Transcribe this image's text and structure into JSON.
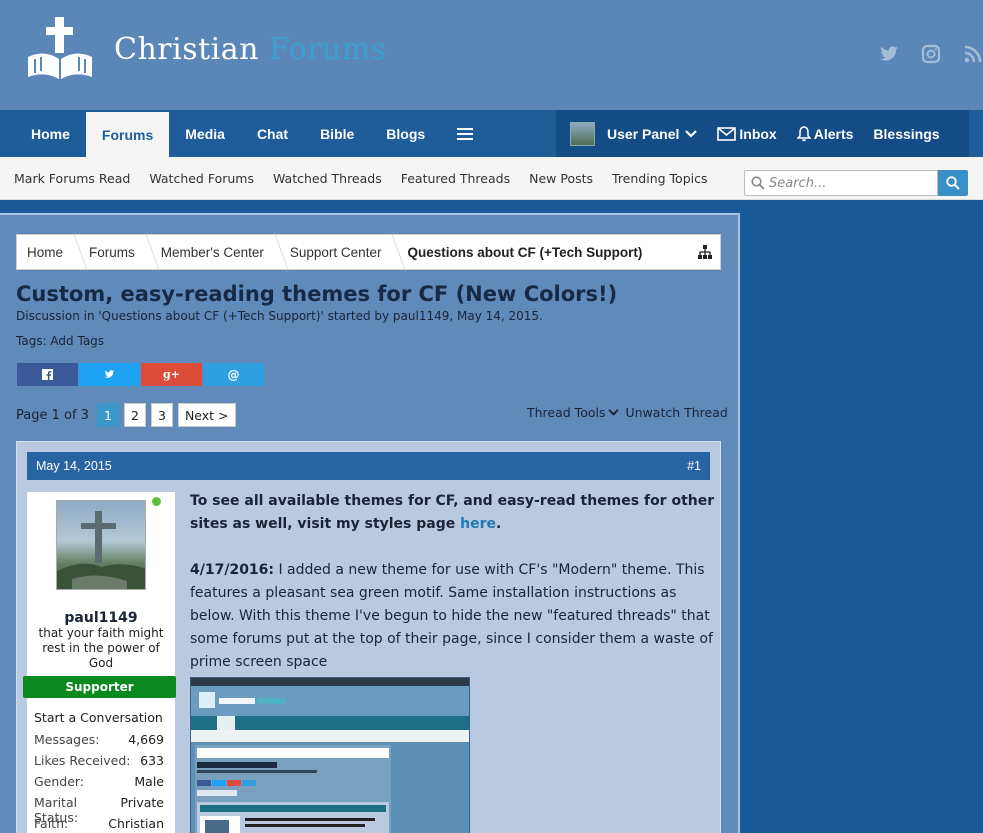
{
  "header": {
    "logo_word_1": "Christian",
    "logo_word_2": "Forums"
  },
  "nav": {
    "left_tabs": [
      "Home",
      "Forums",
      "Media",
      "Chat",
      "Bible",
      "Blogs"
    ],
    "active_tab": "Forums",
    "user_panel": "User Panel",
    "inbox": "Inbox",
    "alerts": "Alerts",
    "blessings": "Blessings"
  },
  "subnav": {
    "links": [
      "Mark Forums Read",
      "Watched Forums",
      "Watched Threads",
      "Featured Threads",
      "New Posts",
      "Trending Topics"
    ]
  },
  "search": {
    "placeholder": "Search..."
  },
  "breadcrumb": [
    "Home",
    "Forums",
    "Member's Center",
    "Support Center",
    "Questions about CF (+Tech Support)"
  ],
  "thread": {
    "title": "Custom, easy-reading themes for CF (New Colors!)",
    "meta": "Discussion in 'Questions about CF (+Tech Support)' started by paul1149, May 14, 2015.",
    "tags": "Tags: Add Tags"
  },
  "pagination": {
    "label": "Page 1 of 3",
    "pages": [
      "1",
      "2",
      "3"
    ],
    "current": "1",
    "next": "Next >"
  },
  "thread_tools": {
    "tools": "Thread Tools",
    "unwatch": "Unwatch Thread"
  },
  "post": {
    "date": "May 14, 2015",
    "number": "#1",
    "username": "paul1149",
    "user_title": "that your faith might rest in the power of God",
    "banner": "Supporter",
    "start_conversation": "Start a Conversation",
    "stats": [
      {
        "label": "Messages:",
        "value": "4,669"
      },
      {
        "label": "Likes Received:",
        "value": "633"
      },
      {
        "label": "Gender:",
        "value": "Male"
      },
      {
        "label": "Marital Status:",
        "value": "Private"
      },
      {
        "label": "Faith:",
        "value": "Christian"
      }
    ],
    "p1_text": "To see all available themes for CF, and easy-read themes for other sites as well, visit my styles page ",
    "p1_link": "here",
    "p1_end": ".",
    "p2_date": "4/17/2016:",
    "p2_text": " I added a new theme for use with CF's \"Modern\" theme. This features a pleasant sea green motif. Same installation instructions as below. With this theme I've begun to hide the new \"featured threads\" that some forums put at the top of their page, since I consider them a waste of prime screen space"
  },
  "colors": {
    "header_bg": "#5b87b8",
    "nav_bg": "#1f5c9a",
    "accent": "#3a98c9",
    "supporter": "#0a8a1e"
  }
}
